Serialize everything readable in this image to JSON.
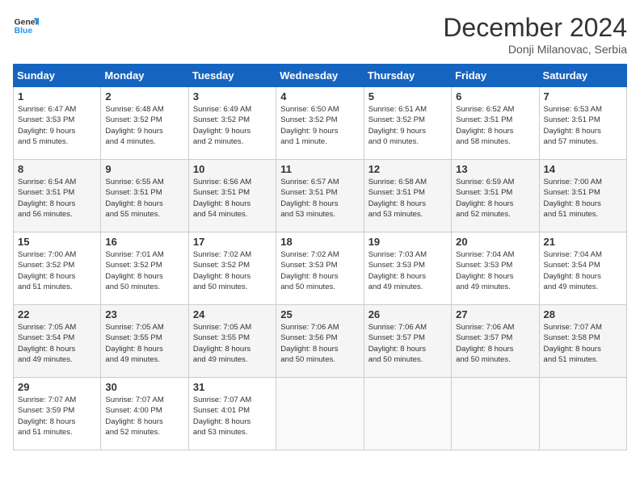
{
  "logo": {
    "line1": "General",
    "line2": "Blue"
  },
  "title": "December 2024",
  "subtitle": "Donji Milanovac, Serbia",
  "days_of_week": [
    "Sunday",
    "Monday",
    "Tuesday",
    "Wednesday",
    "Thursday",
    "Friday",
    "Saturday"
  ],
  "weeks": [
    [
      {
        "day": "1",
        "info": "Sunrise: 6:47 AM\nSunset: 3:53 PM\nDaylight: 9 hours\nand 5 minutes."
      },
      {
        "day": "2",
        "info": "Sunrise: 6:48 AM\nSunset: 3:52 PM\nDaylight: 9 hours\nand 4 minutes."
      },
      {
        "day": "3",
        "info": "Sunrise: 6:49 AM\nSunset: 3:52 PM\nDaylight: 9 hours\nand 2 minutes."
      },
      {
        "day": "4",
        "info": "Sunrise: 6:50 AM\nSunset: 3:52 PM\nDaylight: 9 hours\nand 1 minute."
      },
      {
        "day": "5",
        "info": "Sunrise: 6:51 AM\nSunset: 3:52 PM\nDaylight: 9 hours\nand 0 minutes."
      },
      {
        "day": "6",
        "info": "Sunrise: 6:52 AM\nSunset: 3:51 PM\nDaylight: 8 hours\nand 58 minutes."
      },
      {
        "day": "7",
        "info": "Sunrise: 6:53 AM\nSunset: 3:51 PM\nDaylight: 8 hours\nand 57 minutes."
      }
    ],
    [
      {
        "day": "8",
        "info": "Sunrise: 6:54 AM\nSunset: 3:51 PM\nDaylight: 8 hours\nand 56 minutes."
      },
      {
        "day": "9",
        "info": "Sunrise: 6:55 AM\nSunset: 3:51 PM\nDaylight: 8 hours\nand 55 minutes."
      },
      {
        "day": "10",
        "info": "Sunrise: 6:56 AM\nSunset: 3:51 PM\nDaylight: 8 hours\nand 54 minutes."
      },
      {
        "day": "11",
        "info": "Sunrise: 6:57 AM\nSunset: 3:51 PM\nDaylight: 8 hours\nand 53 minutes."
      },
      {
        "day": "12",
        "info": "Sunrise: 6:58 AM\nSunset: 3:51 PM\nDaylight: 8 hours\nand 53 minutes."
      },
      {
        "day": "13",
        "info": "Sunrise: 6:59 AM\nSunset: 3:51 PM\nDaylight: 8 hours\nand 52 minutes."
      },
      {
        "day": "14",
        "info": "Sunrise: 7:00 AM\nSunset: 3:51 PM\nDaylight: 8 hours\nand 51 minutes."
      }
    ],
    [
      {
        "day": "15",
        "info": "Sunrise: 7:00 AM\nSunset: 3:52 PM\nDaylight: 8 hours\nand 51 minutes."
      },
      {
        "day": "16",
        "info": "Sunrise: 7:01 AM\nSunset: 3:52 PM\nDaylight: 8 hours\nand 50 minutes."
      },
      {
        "day": "17",
        "info": "Sunrise: 7:02 AM\nSunset: 3:52 PM\nDaylight: 8 hours\nand 50 minutes."
      },
      {
        "day": "18",
        "info": "Sunrise: 7:02 AM\nSunset: 3:53 PM\nDaylight: 8 hours\nand 50 minutes."
      },
      {
        "day": "19",
        "info": "Sunrise: 7:03 AM\nSunset: 3:53 PM\nDaylight: 8 hours\nand 49 minutes."
      },
      {
        "day": "20",
        "info": "Sunrise: 7:04 AM\nSunset: 3:53 PM\nDaylight: 8 hours\nand 49 minutes."
      },
      {
        "day": "21",
        "info": "Sunrise: 7:04 AM\nSunset: 3:54 PM\nDaylight: 8 hours\nand 49 minutes."
      }
    ],
    [
      {
        "day": "22",
        "info": "Sunrise: 7:05 AM\nSunset: 3:54 PM\nDaylight: 8 hours\nand 49 minutes."
      },
      {
        "day": "23",
        "info": "Sunrise: 7:05 AM\nSunset: 3:55 PM\nDaylight: 8 hours\nand 49 minutes."
      },
      {
        "day": "24",
        "info": "Sunrise: 7:05 AM\nSunset: 3:55 PM\nDaylight: 8 hours\nand 49 minutes."
      },
      {
        "day": "25",
        "info": "Sunrise: 7:06 AM\nSunset: 3:56 PM\nDaylight: 8 hours\nand 50 minutes."
      },
      {
        "day": "26",
        "info": "Sunrise: 7:06 AM\nSunset: 3:57 PM\nDaylight: 8 hours\nand 50 minutes."
      },
      {
        "day": "27",
        "info": "Sunrise: 7:06 AM\nSunset: 3:57 PM\nDaylight: 8 hours\nand 50 minutes."
      },
      {
        "day": "28",
        "info": "Sunrise: 7:07 AM\nSunset: 3:58 PM\nDaylight: 8 hours\nand 51 minutes."
      }
    ],
    [
      {
        "day": "29",
        "info": "Sunrise: 7:07 AM\nSunset: 3:59 PM\nDaylight: 8 hours\nand 51 minutes."
      },
      {
        "day": "30",
        "info": "Sunrise: 7:07 AM\nSunset: 4:00 PM\nDaylight: 8 hours\nand 52 minutes."
      },
      {
        "day": "31",
        "info": "Sunrise: 7:07 AM\nSunset: 4:01 PM\nDaylight: 8 hours\nand 53 minutes."
      },
      null,
      null,
      null,
      null
    ]
  ]
}
